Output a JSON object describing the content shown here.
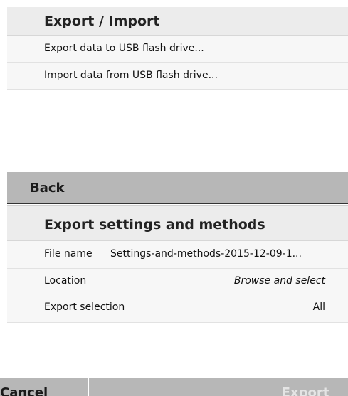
{
  "export_import": {
    "title": "Export / Import",
    "items": [
      {
        "label": "Export data to USB flash drive..."
      },
      {
        "label": "Import data from USB flash drive..."
      }
    ],
    "footer": {
      "back_label": "Back"
    }
  },
  "export_settings": {
    "title": "Export settings and methods",
    "fields": [
      {
        "label": "File name",
        "value": "Settings-and-methods-2015-12-09-1..."
      },
      {
        "label": "Location",
        "value": "Browse and select"
      },
      {
        "label": "Export selection",
        "value": "All"
      }
    ],
    "footer": {
      "cancel_label": "Cancel",
      "export_label": "Export"
    }
  }
}
